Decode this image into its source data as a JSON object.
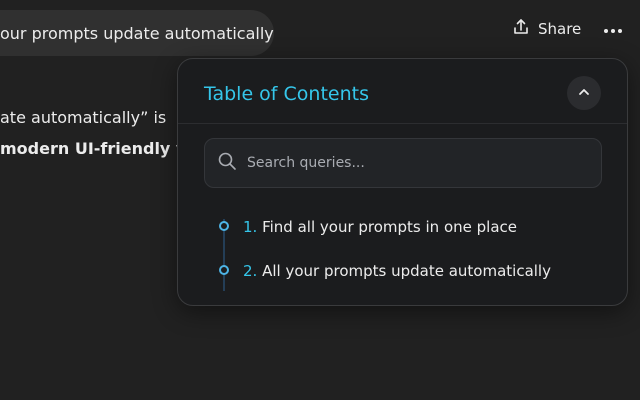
{
  "conversation": {
    "title_chip": "our prompts update automatically",
    "line1": "ate automatically” is",
    "line2": "modern UI-friendly versions:"
  },
  "header": {
    "share_label": "Share",
    "share_icon": "share-icon",
    "more_icon": "ellipsis-icon"
  },
  "toc": {
    "title": "Table of Contents",
    "collapse_icon": "chevron-up-icon",
    "search": {
      "placeholder": "Search queries...",
      "value": ""
    },
    "items": [
      {
        "number": "1.",
        "label": "Find all your prompts in one place"
      },
      {
        "number": "2.",
        "label": "All your prompts update automatically"
      }
    ]
  },
  "colors": {
    "background": "#212121",
    "accent": "#35c6ea",
    "panel": "#1b1c1e"
  }
}
